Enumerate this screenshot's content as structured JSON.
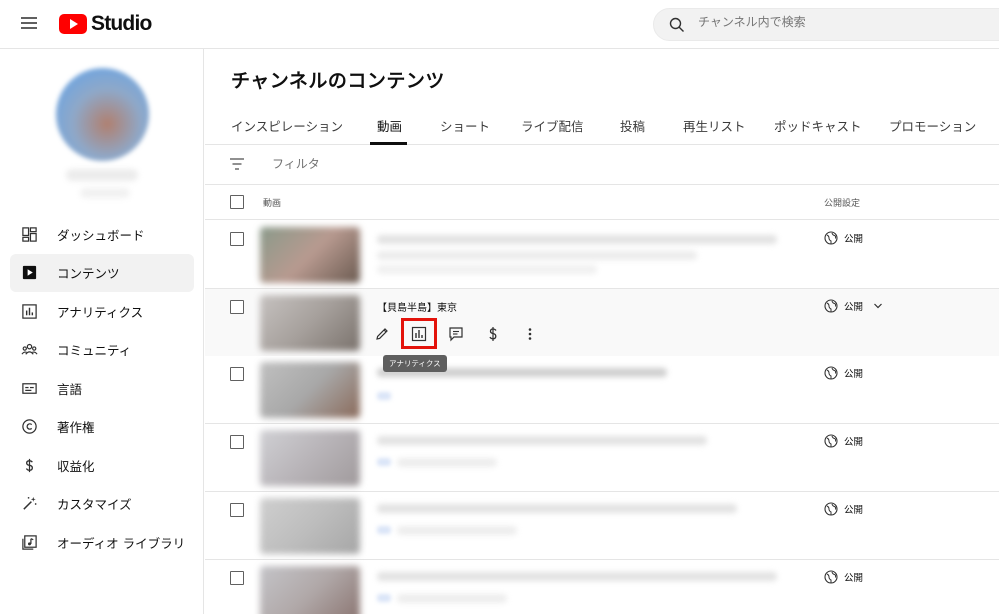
{
  "header": {
    "logo_text": "Studio",
    "search_placeholder": "チャンネル内で検索"
  },
  "sidebar": {
    "items": [
      {
        "label": "ダッシュボード",
        "icon": "dashboard-icon"
      },
      {
        "label": "コンテンツ",
        "icon": "content-icon",
        "active": true
      },
      {
        "label": "アナリティクス",
        "icon": "analytics-icon"
      },
      {
        "label": "コミュニティ",
        "icon": "community-icon"
      },
      {
        "label": "言語",
        "icon": "subtitles-icon"
      },
      {
        "label": "著作権",
        "icon": "copyright-icon"
      },
      {
        "label": "収益化",
        "icon": "dollar-icon"
      },
      {
        "label": "カスタマイズ",
        "icon": "magic-wand-icon"
      },
      {
        "label": "オーディオ ライブラリ",
        "icon": "audio-library-icon"
      }
    ]
  },
  "main": {
    "title": "チャンネルのコンテンツ",
    "tabs": [
      {
        "label": "インスピレーション"
      },
      {
        "label": "動画",
        "active": true
      },
      {
        "label": "ショート"
      },
      {
        "label": "ライブ配信"
      },
      {
        "label": "投稿"
      },
      {
        "label": "再生リスト"
      },
      {
        "label": "ポッドキャスト"
      },
      {
        "label": "プロモーション"
      }
    ],
    "filter_label": "フィルタ",
    "columns": {
      "video": "動画",
      "visibility": "公開設定"
    },
    "rows": [
      {
        "visibility": "公開"
      },
      {
        "visibility": "公開",
        "title": "【貝島半島】東京",
        "hovered": true
      },
      {
        "visibility": "公開"
      },
      {
        "visibility": "公開"
      },
      {
        "visibility": "公開"
      },
      {
        "visibility": "公開"
      }
    ],
    "tooltip": "アナリティクス",
    "highlight_color": "#e3130b"
  }
}
